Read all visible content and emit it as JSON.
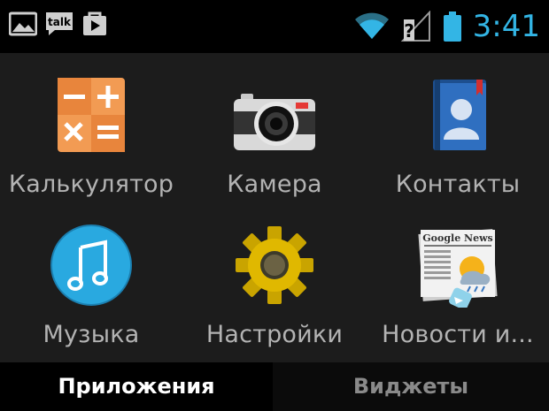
{
  "status_bar": {
    "time": "3:41",
    "left_icons": [
      "gallery-icon",
      "talk-icon",
      "play-store-icon"
    ],
    "right_icons": [
      "wifi-icon",
      "no-sim-icon",
      "battery-icon"
    ],
    "talk_text": "talk",
    "accent_color": "#33b5e5"
  },
  "apps": [
    {
      "label": "Калькулятор",
      "icon": "calculator-icon"
    },
    {
      "label": "Камера",
      "icon": "camera-icon"
    },
    {
      "label": "Контакты",
      "icon": "contacts-icon"
    },
    {
      "label": "Музыка",
      "icon": "music-icon"
    },
    {
      "label": "Настройки",
      "icon": "settings-icon"
    },
    {
      "label": "Новости и...",
      "icon": "news-icon"
    }
  ],
  "news_icon_text": "Google News",
  "tabs": [
    {
      "label": "Приложения",
      "active": true
    },
    {
      "label": "Виджеты",
      "active": false
    }
  ]
}
